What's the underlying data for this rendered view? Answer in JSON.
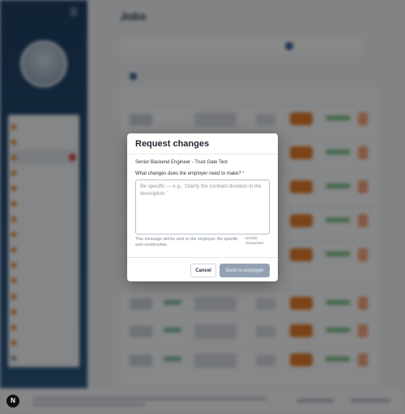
{
  "modal": {
    "title": "Request changes",
    "job_name": "Senior Backend Engineer - Trust Gate Test",
    "field_label": "What changes does the employer need to make?",
    "required_mark": "*",
    "textarea_placeholder": "Be specific — e.g., 'Clarify the contract duration in the description.'",
    "textarea_value": "",
    "help_text": "This message will be sent to the employer. Be specific and constructive.",
    "char_counter": "0/1000 characters",
    "cancel_label": "Cancel",
    "send_label": "Send to employer"
  },
  "background": {
    "page_title": "Jobs"
  },
  "badge": {
    "label": "N"
  },
  "colors": {
    "sidebar": "#1f3f63",
    "accent_orange": "#e07a2a",
    "send_disabled": "#93a2b3",
    "required": "#d33a3a"
  }
}
